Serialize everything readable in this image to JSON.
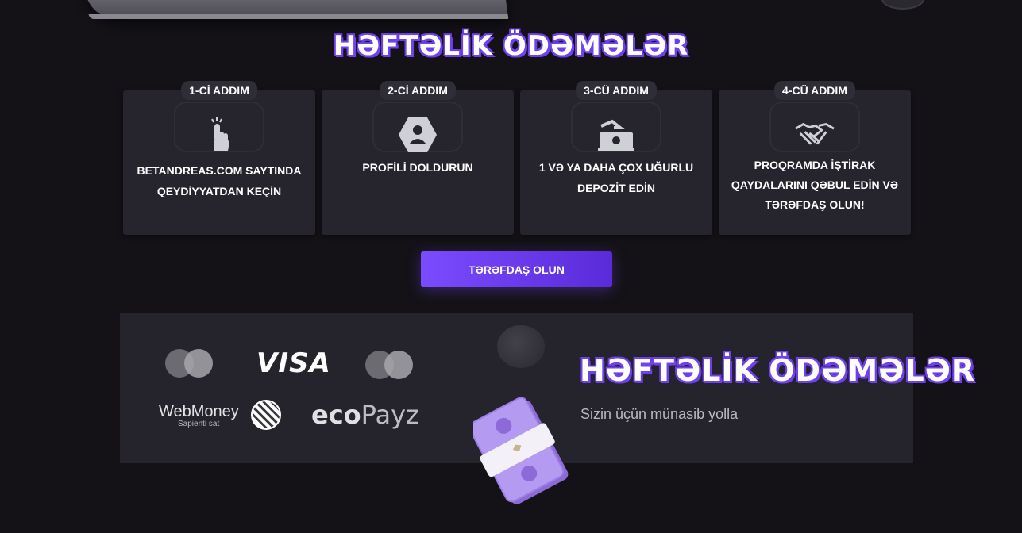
{
  "header": {
    "title": "HƏFTƏLİK ÖDƏMƏLƏR"
  },
  "steps": [
    {
      "badge": "1-Cİ ADDIM",
      "icon": "hand-pointer-icon",
      "text_lines": [
        "BETANDREAS.COM SAYTINDA",
        "QEYDİYYATDAN KEÇİN"
      ]
    },
    {
      "badge": "2-Cİ ADDIM",
      "icon": "user-profile-icon",
      "text_lines": [
        "PROFİLİ DOLDURUN"
      ]
    },
    {
      "badge": "3-CÜ ADDIM",
      "icon": "deposit-money-icon",
      "text_lines": [
        "1 VƏ YA DAHA ÇOX UĞURLU",
        "DEPOZİT EDİN"
      ]
    },
    {
      "badge": "4-CÜ ADDIM",
      "icon": "handshake-icon",
      "text_lines": [
        "PROQRAMDA İŞTİRAK",
        "QAYDALARINI QƏBUL EDİN VƏ",
        "TƏRƏFDAŞ OLUN!"
      ]
    }
  ],
  "cta": {
    "label": "TƏRƏFDAŞ OLUN"
  },
  "payments": {
    "logos": {
      "visa": "VISA",
      "webmoney": "WebMoney",
      "webmoney_sub": "Sapienti sat",
      "ecopayz_eco": "eco",
      "ecopayz_payz": "Payz"
    },
    "title": "HƏFTƏLİK ÖDƏMƏLƏR",
    "subtitle": "Sizin üçün münasib yolla"
  },
  "colors": {
    "accent": "#6f3ff0",
    "background": "#141217",
    "card": "#26252d",
    "panel": "#25242c"
  }
}
